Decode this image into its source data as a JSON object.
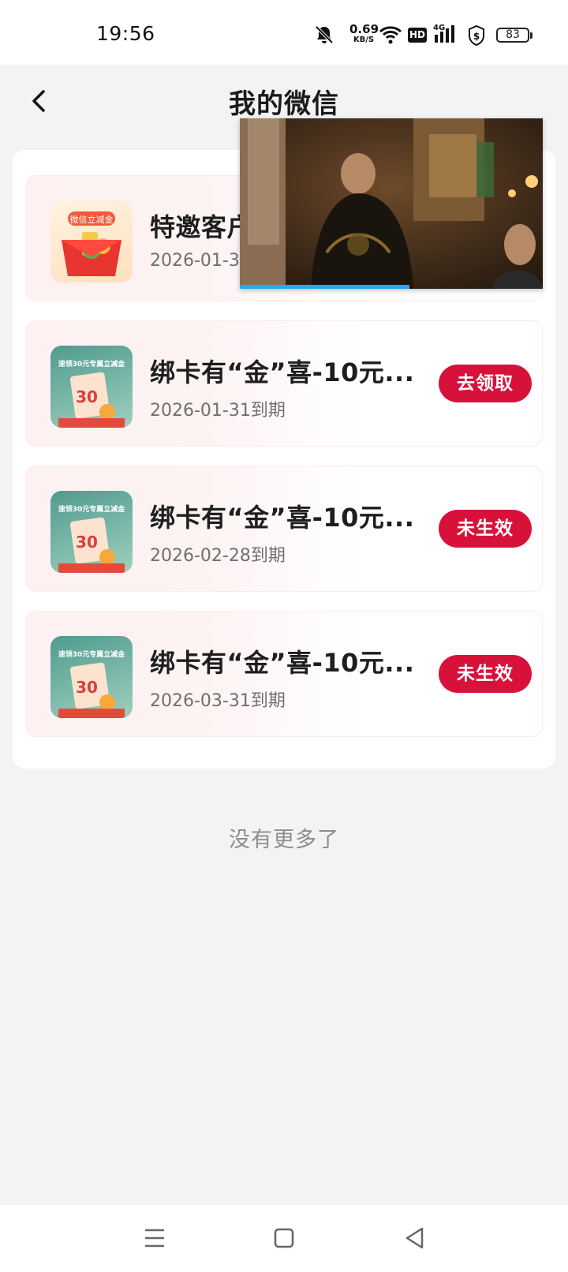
{
  "status_bar": {
    "time": "19:56",
    "net_speed_value": "0.69",
    "net_speed_unit": "KB/S",
    "hd_label": "HD",
    "network_label": "4G",
    "battery_level": "83",
    "icons": [
      "mute-bell-icon",
      "wifi-icon",
      "hd-icon",
      "signal-4g-icon",
      "shield-dollar-icon",
      "battery-icon"
    ]
  },
  "nav": {
    "back_icon": "chevron-left-icon",
    "title": "我的微信"
  },
  "coupons": [
    {
      "title": "特邀客户",
      "date": "2026-01-31",
      "thumb_label": "微信立减金",
      "button": ""
    },
    {
      "title": "绑卡有“金”喜-10元...",
      "date": "2026-01-31到期",
      "thumb_label": "速领30元专属立减金",
      "thumb_value": "30",
      "button": "去领取"
    },
    {
      "title": "绑卡有“金”喜-10元...",
      "date": "2026-02-28到期",
      "thumb_label": "速领30元专属立减金",
      "thumb_value": "30",
      "button": "未生效"
    },
    {
      "title": "绑卡有“金”喜-10元...",
      "date": "2026-03-31到期",
      "thumb_label": "速领30元专属立减金",
      "thumb_value": "30",
      "button": "未生效"
    }
  ],
  "footer_text": "没有更多了",
  "video": {
    "progress": 0.56
  },
  "system_nav": {
    "icons": [
      "menu-icon",
      "home-square-icon",
      "back-triangle-icon"
    ]
  },
  "colors": {
    "accent": "#d8113b",
    "progress": "#29a7f0",
    "background": "#f3f3f3"
  }
}
